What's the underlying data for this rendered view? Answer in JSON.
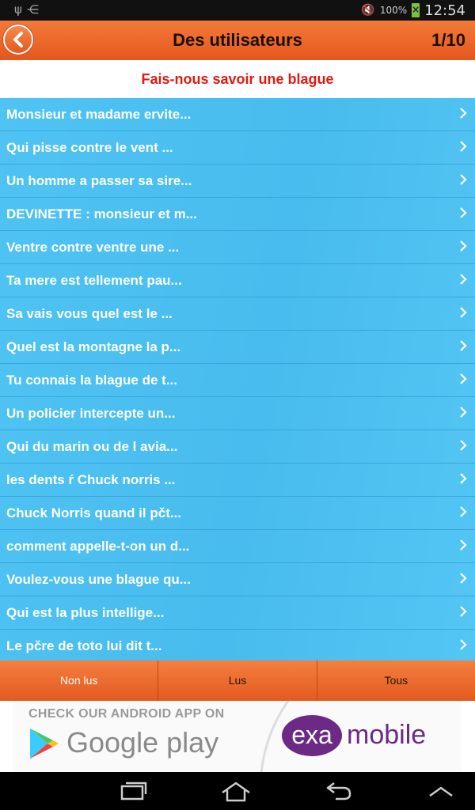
{
  "status_bar": {
    "battery": "100%",
    "time": "12:54"
  },
  "header": {
    "title": "Des utilisateurs",
    "page_counter": "1/10"
  },
  "prompt": "Fais-nous savoir une blague",
  "jokes": [
    "Monsieur et madame ervite...",
    "Qui pisse contre le vent ...",
    "Un homme a passer sa sire...",
    "DEVINETTE : monsieur et m...",
    "Ventre contre ventre une ...",
    "Ta mere est tellement pau...",
    "Sa vais vous quel est le ...",
    "Quel est la montagne la p...",
    "Tu connais la blague de t...",
    "Un policier intercepte un...",
    "Qui du marin ou de l avia...",
    "les dents ŕ Chuck norris ...",
    "Chuck Norris quand il pčt...",
    "comment appelle-t-on un d...",
    "Voulez-vous une blague qu...",
    "Qui est la plus intellige...",
    "Le pčre de toto lui dit t..."
  ],
  "tabs": [
    {
      "label": "Non lus"
    },
    {
      "label": "Lus"
    },
    {
      "label": "Tous"
    }
  ],
  "ad": {
    "check_text": "CHECK OUR ANDROID APP ON",
    "store_text": "Google play",
    "brand_circle": "exa",
    "brand_rest": "mobile"
  },
  "colors": {
    "header": "#e4571d",
    "list": "#4fc3f2",
    "prompt_text": "#e01a12",
    "brand": "#6b2a86"
  }
}
